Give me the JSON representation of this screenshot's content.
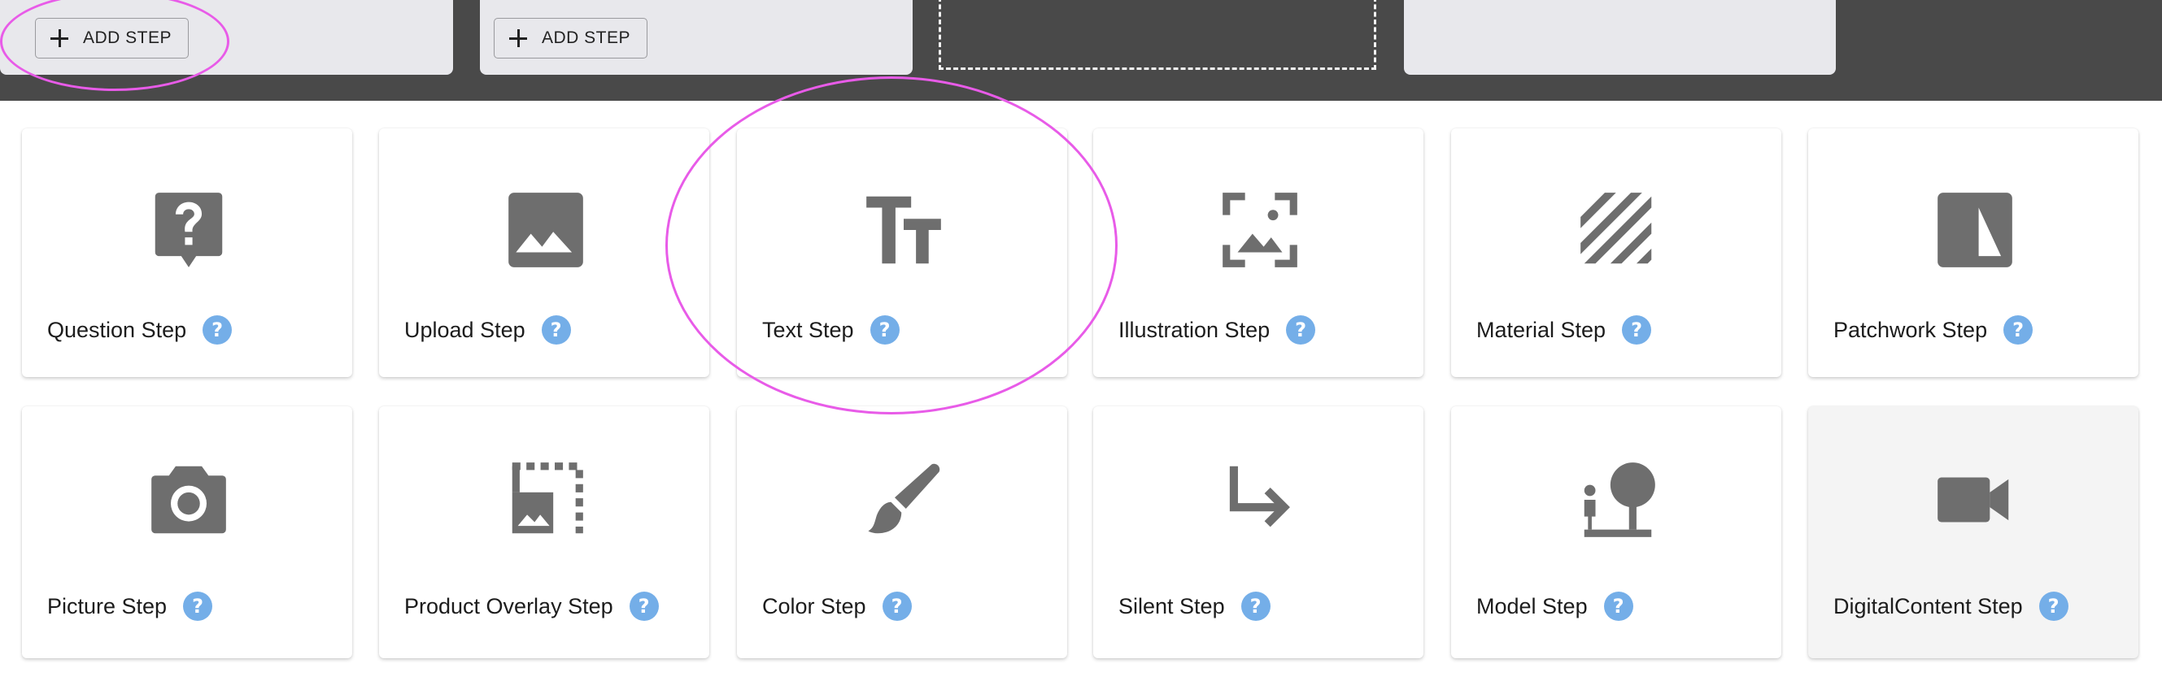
{
  "toolbar": {
    "add_step_1": "ADD STEP",
    "add_step_2": "ADD STEP"
  },
  "steps": [
    {
      "label": "Question Step",
      "icon": "question-bubble-icon"
    },
    {
      "label": "Upload Step",
      "icon": "image-icon"
    },
    {
      "label": "Text Step",
      "icon": "text-size-icon"
    },
    {
      "label": "Illustration Step",
      "icon": "image-focus-icon"
    },
    {
      "label": "Material Step",
      "icon": "texture-icon"
    },
    {
      "label": "Patchwork Step",
      "icon": "patchwork-icon"
    },
    {
      "label": "Picture Step",
      "icon": "camera-icon"
    },
    {
      "label": "Product Overlay Step",
      "icon": "overlay-image-icon"
    },
    {
      "label": "Color Step",
      "icon": "brush-icon"
    },
    {
      "label": "Silent Step",
      "icon": "subdirectory-arrow-icon"
    },
    {
      "label": "Model Step",
      "icon": "nature-people-icon"
    },
    {
      "label": "DigitalContent Step",
      "icon": "video-camera-icon"
    }
  ],
  "help_glyph": "?",
  "colors": {
    "topbar": "#494949",
    "panel": "#e8e8ec",
    "icon": "#6e6e6e",
    "help": "#74aee8",
    "annotation": "#e85be8"
  }
}
